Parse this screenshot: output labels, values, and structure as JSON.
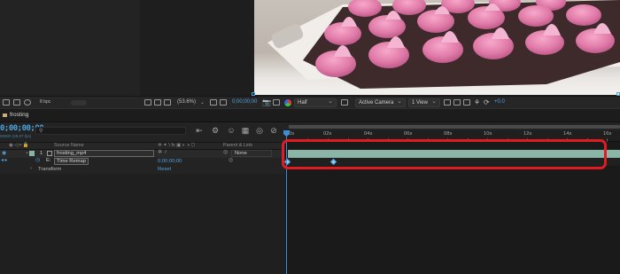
{
  "viewer": {
    "footage_icon": "pink-meringue-tray-image",
    "magnification": "(53.6%)",
    "timecode": "0;00;00;00",
    "resolution": "Half",
    "camera": "Active Camera",
    "views": "1 View",
    "exposure": "+0.0",
    "fps_label": "8 bpc",
    "accent": "#4ea4e0"
  },
  "timeline": {
    "tab_label": "frosting",
    "timecode": "0;00;00;00",
    "fps_sub": "00000 (29.97 fps)",
    "search_icon": "search-icon",
    "headers": {
      "source_name": "Source Name",
      "parent_link": "Parent & Link"
    },
    "layer": {
      "index": "1",
      "name": "frosting_mp4",
      "parent": "None"
    },
    "time_remap": {
      "label": "Time Remap",
      "value": "0;00;00;00"
    },
    "transform": {
      "label": "Transform",
      "reset": "Reset"
    },
    "ruler": [
      "0s",
      "02s",
      "04s",
      "06s",
      "08s",
      "10s",
      "12s",
      "14s",
      "16s"
    ],
    "layer_bar_color": "#8ab4a5",
    "highlight_color": "#e01b22"
  }
}
